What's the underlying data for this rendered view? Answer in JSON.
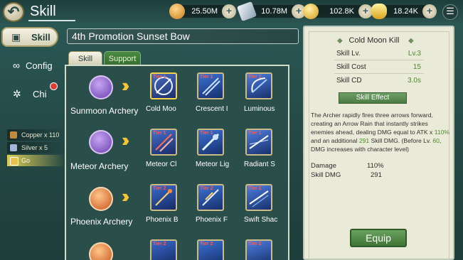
{
  "header": {
    "title": "Skill",
    "back_icon": "curved-back-arrow-icon",
    "currencies": [
      {
        "name": "gold-coin-icon",
        "value": "25.50M",
        "color": "#e8a43a"
      },
      {
        "name": "silver-bar-icon",
        "value": "10.78M",
        "color": "#c9d3dc"
      },
      {
        "name": "winged-coin-icon",
        "value": "102.8K",
        "color": "#f2c339"
      },
      {
        "name": "gold-ingot-icon",
        "value": "18.24K",
        "color": "#f6d24a"
      }
    ],
    "menu_icon": "list-menu-icon"
  },
  "nav": {
    "items": [
      {
        "label": "Skill",
        "icon": "cards-icon",
        "active": true
      },
      {
        "label": "Config",
        "icon": "link-chain-icon"
      },
      {
        "label": "Chi",
        "icon": "swirl-icon",
        "alert": true
      }
    ],
    "materials": [
      {
        "label": "Copper",
        "count": "x 110",
        "color": "#c28a3c"
      },
      {
        "label": "Silver",
        "count": "x 5",
        "color": "#9fb7d8"
      },
      {
        "label": "Go",
        "count": "",
        "color": "#e8c24a"
      }
    ]
  },
  "main": {
    "promotion_title": "4th Promotion Sunset Bow",
    "tabs": [
      {
        "label": "Skill",
        "active": true
      },
      {
        "label": "Support",
        "active": false
      }
    ],
    "rows": [
      {
        "name": "Sunmoon Archery",
        "badge_color": "#9b6ad6",
        "skills": [
          {
            "tier": "Tier 1",
            "name": "Cold Moo",
            "selected": true
          },
          {
            "tier": "Tier 1",
            "name": "Crescent I"
          },
          {
            "tier": "Tier 1",
            "name": "Luminous"
          }
        ]
      },
      {
        "name": "Meteor Archery",
        "badge_color": "#9b6ad6",
        "skills": [
          {
            "tier": "Tier 1",
            "name": "Meteor Cl"
          },
          {
            "tier": "Tier 1",
            "name": "Meteor Lig"
          },
          {
            "tier": "Tier 1",
            "name": "Radiant S"
          }
        ]
      },
      {
        "name": "Phoenix Archery",
        "badge_color": "#e47a2e",
        "skills": [
          {
            "tier": "Tier 2",
            "name": "Phoenix B"
          },
          {
            "tier": "Tier 2",
            "name": "Phoenix F"
          },
          {
            "tier": "Tier 2",
            "name": "Swift Shac"
          }
        ]
      },
      {
        "name": "",
        "badge_color": "#e47a2e",
        "skills": [
          {
            "tier": "Tier 2",
            "name": ""
          },
          {
            "tier": "Tier 2",
            "name": ""
          },
          {
            "tier": "Tier 2",
            "name": ""
          }
        ]
      }
    ]
  },
  "detail": {
    "skill_name": "Cold Moon Kill",
    "stats": [
      {
        "label": "Skill Lv.",
        "value": "Lv.3"
      },
      {
        "label": "Skill Cost",
        "value": "15"
      },
      {
        "label": "Skill CD",
        "value": "3.0s"
      }
    ],
    "effect_title": "Skill Effect",
    "effect_parts": [
      {
        "text": "The Archer rapidly fires three arrows forward, creating an Arrow Rain that instantly strikes enemies ahead, dealing DMG equal to ATK x ",
        "hl": false
      },
      {
        "text": "110%",
        "hl": true
      },
      {
        "text": " and an additional ",
        "hl": false
      },
      {
        "text": "291",
        "hl": true
      },
      {
        "text": " Skill DMG. (Before Lv. ",
        "hl": false
      },
      {
        "text": "60",
        "hl": true
      },
      {
        "text": ", DMG increases with character level)",
        "hl": false
      }
    ],
    "summary": [
      {
        "label": "Damage",
        "value": "110%"
      },
      {
        "label": "Skill DMG",
        "value": "291"
      }
    ],
    "equip_label": "Equip"
  }
}
